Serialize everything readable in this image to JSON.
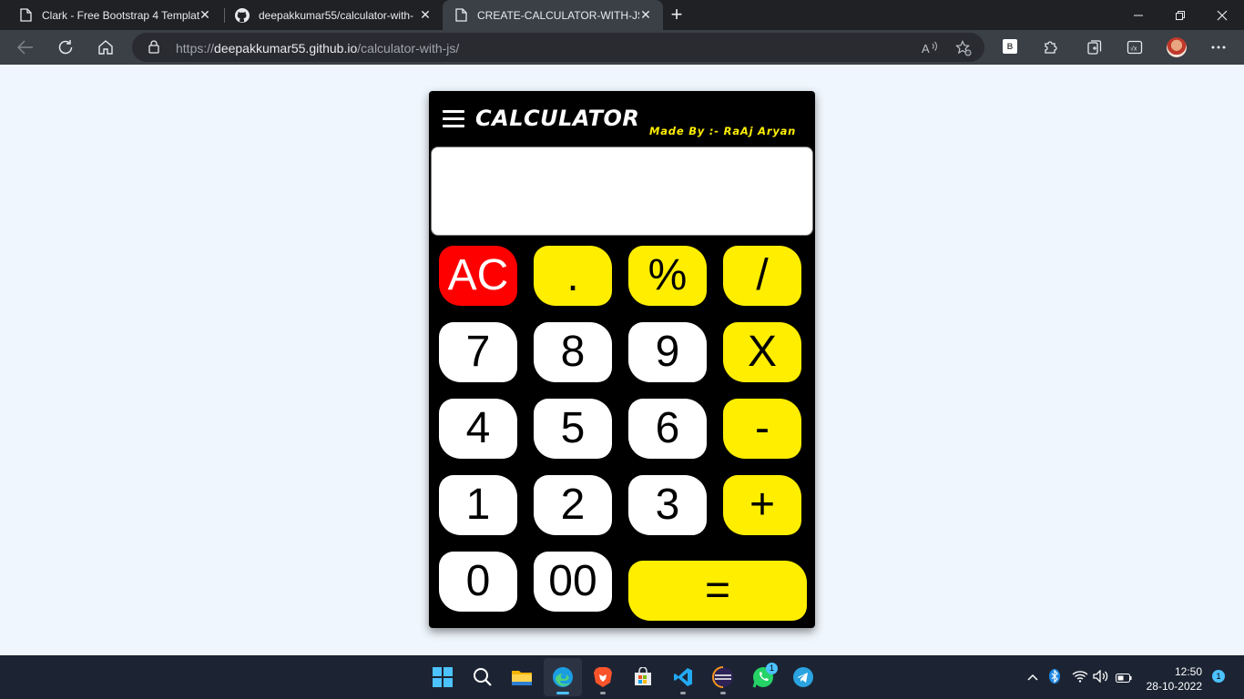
{
  "browser": {
    "tabs": [
      {
        "title": "Clark - Free Bootstrap 4 Templat",
        "icon": "page-icon"
      },
      {
        "title": "deepakkumar55/calculator-with-",
        "icon": "github-icon"
      },
      {
        "title": "CREATE-CALCULATOR-WITH-JS",
        "icon": "page-icon"
      }
    ],
    "url": {
      "proto": "https://",
      "host": "deepakkumar55.github.io",
      "path": "/calculator-with-js/"
    }
  },
  "calculator": {
    "title": "CALCULATOR",
    "author": "Made By :- RaAj Aryan",
    "display_value": "",
    "keys": {
      "ac": "AC",
      "dot": ".",
      "percent": "%",
      "divide": "/",
      "seven": "7",
      "eight": "8",
      "nine": "9",
      "multiply": "X",
      "four": "4",
      "five": "5",
      "six": "6",
      "minus": "-",
      "one": "1",
      "two": "2",
      "three": "3",
      "plus": "+",
      "zero": "0",
      "double_zero": "00",
      "equals": "="
    },
    "colors": {
      "operator": "#ffee00",
      "clear": "#ff0000",
      "number": "#ffffff",
      "body": "#000000"
    }
  },
  "taskbar": {
    "time": "12:50",
    "date": "28-10-2022",
    "notifications": "1",
    "whatsapp_badge": "1"
  }
}
